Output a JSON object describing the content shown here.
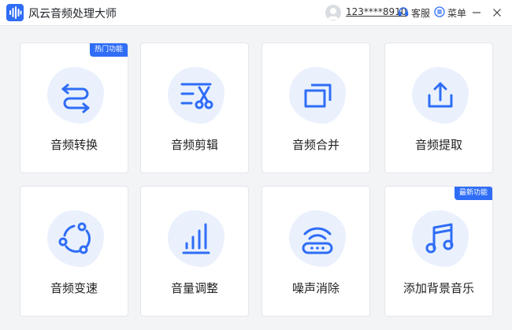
{
  "app": {
    "title": "风云音频处理大师",
    "accent": "#2f6df6",
    "icon": "audio-wave-icon"
  },
  "header": {
    "user_id": "123****8910",
    "service_label": "客服",
    "menu_label": "菜单"
  },
  "features": [
    {
      "label": "音频转换",
      "icon": "convert-arrows-icon",
      "badge": "热门功能"
    },
    {
      "label": "音频剪辑",
      "icon": "scissors-icon",
      "badge": ""
    },
    {
      "label": "音频合并",
      "icon": "merge-squares-icon",
      "badge": ""
    },
    {
      "label": "音频提取",
      "icon": "upload-tray-icon",
      "badge": ""
    },
    {
      "label": "音频变速",
      "icon": "speed-circle-icon",
      "badge": ""
    },
    {
      "label": "音量调整",
      "icon": "volume-bars-icon",
      "badge": ""
    },
    {
      "label": "噪声消除",
      "icon": "noise-router-icon",
      "badge": ""
    },
    {
      "label": "添加背景音乐",
      "icon": "music-note-icon",
      "badge": "最新功能"
    }
  ]
}
